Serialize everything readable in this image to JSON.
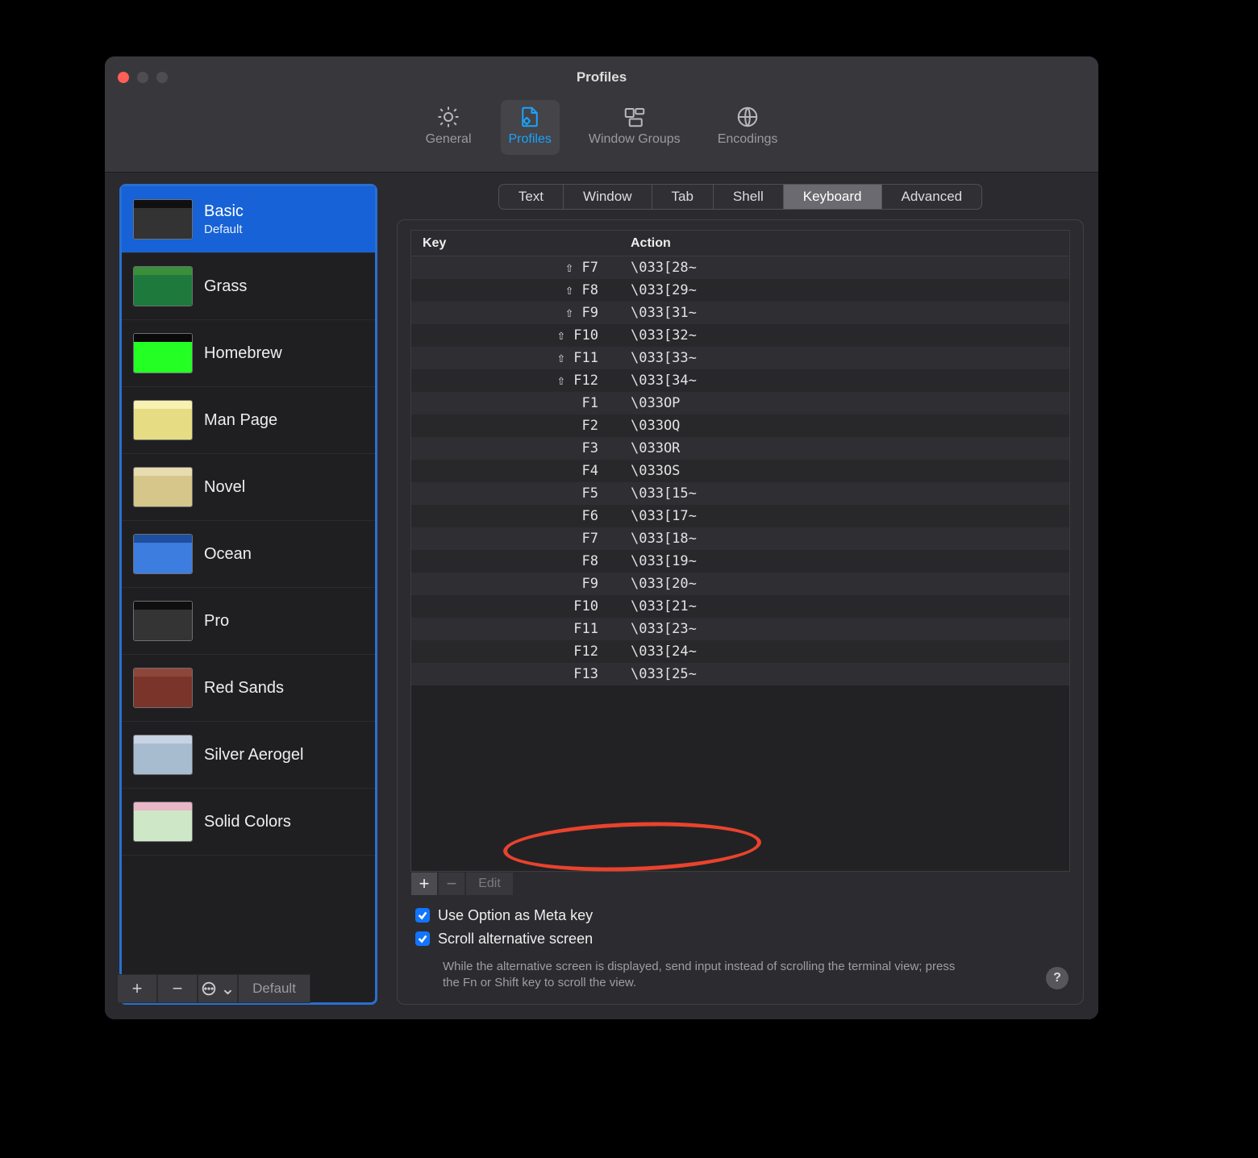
{
  "window": {
    "title": "Profiles"
  },
  "toolbar": [
    {
      "id": "general",
      "label": "General"
    },
    {
      "id": "profiles",
      "label": "Profiles",
      "active": true
    },
    {
      "id": "window-groups",
      "label": "Window Groups"
    },
    {
      "id": "encodings",
      "label": "Encodings"
    }
  ],
  "profiles": [
    {
      "name": "Basic",
      "subtitle": "Default",
      "selected": true,
      "palette": [
        "#101010",
        "#333333"
      ]
    },
    {
      "name": "Grass",
      "palette": [
        "#3a8f3a",
        "#1e7a3c"
      ]
    },
    {
      "name": "Homebrew",
      "palette": [
        "#0a0a0a",
        "#24ff24"
      ]
    },
    {
      "name": "Man Page",
      "palette": [
        "#f8f1b0",
        "#e6dc83"
      ]
    },
    {
      "name": "Novel",
      "palette": [
        "#e7dcb0",
        "#d6c68a"
      ]
    },
    {
      "name": "Ocean",
      "palette": [
        "#1e4f9e",
        "#3d7de0"
      ]
    },
    {
      "name": "Pro",
      "palette": [
        "#0f0f0f",
        "#343434"
      ]
    },
    {
      "name": "Red Sands",
      "palette": [
        "#8f463a",
        "#7a342a"
      ]
    },
    {
      "name": "Silver Aerogel",
      "palette": [
        "#c7d3e3",
        "#a8bcd0"
      ]
    },
    {
      "name": "Solid Colors",
      "palette": [
        "#e8b7c8",
        "#cde7c7"
      ]
    }
  ],
  "sidebar_footer": {
    "add": "+",
    "remove": "−",
    "default_label": "Default"
  },
  "tabs": [
    "Text",
    "Window",
    "Tab",
    "Shell",
    "Keyboard",
    "Advanced"
  ],
  "active_tab": "Keyboard",
  "table": {
    "headers": {
      "key": "Key",
      "action": "Action"
    },
    "rows": [
      {
        "key": "⇧ F7",
        "action": "\\033[28~"
      },
      {
        "key": "⇧ F8",
        "action": "\\033[29~"
      },
      {
        "key": "⇧ F9",
        "action": "\\033[31~"
      },
      {
        "key": "⇧ F10",
        "action": "\\033[32~"
      },
      {
        "key": "⇧ F11",
        "action": "\\033[33~"
      },
      {
        "key": "⇧ F12",
        "action": "\\033[34~"
      },
      {
        "key": "F1",
        "action": "\\033OP"
      },
      {
        "key": "F2",
        "action": "\\033OQ"
      },
      {
        "key": "F3",
        "action": "\\033OR"
      },
      {
        "key": "F4",
        "action": "\\033OS"
      },
      {
        "key": "F5",
        "action": "\\033[15~"
      },
      {
        "key": "F6",
        "action": "\\033[17~"
      },
      {
        "key": "F7",
        "action": "\\033[18~"
      },
      {
        "key": "F8",
        "action": "\\033[19~"
      },
      {
        "key": "F9",
        "action": "\\033[20~"
      },
      {
        "key": "F10",
        "action": "\\033[21~"
      },
      {
        "key": "F11",
        "action": "\\033[23~"
      },
      {
        "key": "F12",
        "action": "\\033[24~"
      },
      {
        "key": "F13",
        "action": "\\033[25~"
      }
    ]
  },
  "table_footer": {
    "add": "+",
    "remove": "−",
    "edit": "Edit"
  },
  "check_option_meta": {
    "label": "Use Option as Meta key",
    "checked": true
  },
  "check_scroll_alt": {
    "label": "Scroll alternative screen",
    "checked": true
  },
  "hint": "While the alternative screen is displayed, send input instead of scrolling the terminal view; press the Fn or Shift key to scroll the view.",
  "help": "?"
}
